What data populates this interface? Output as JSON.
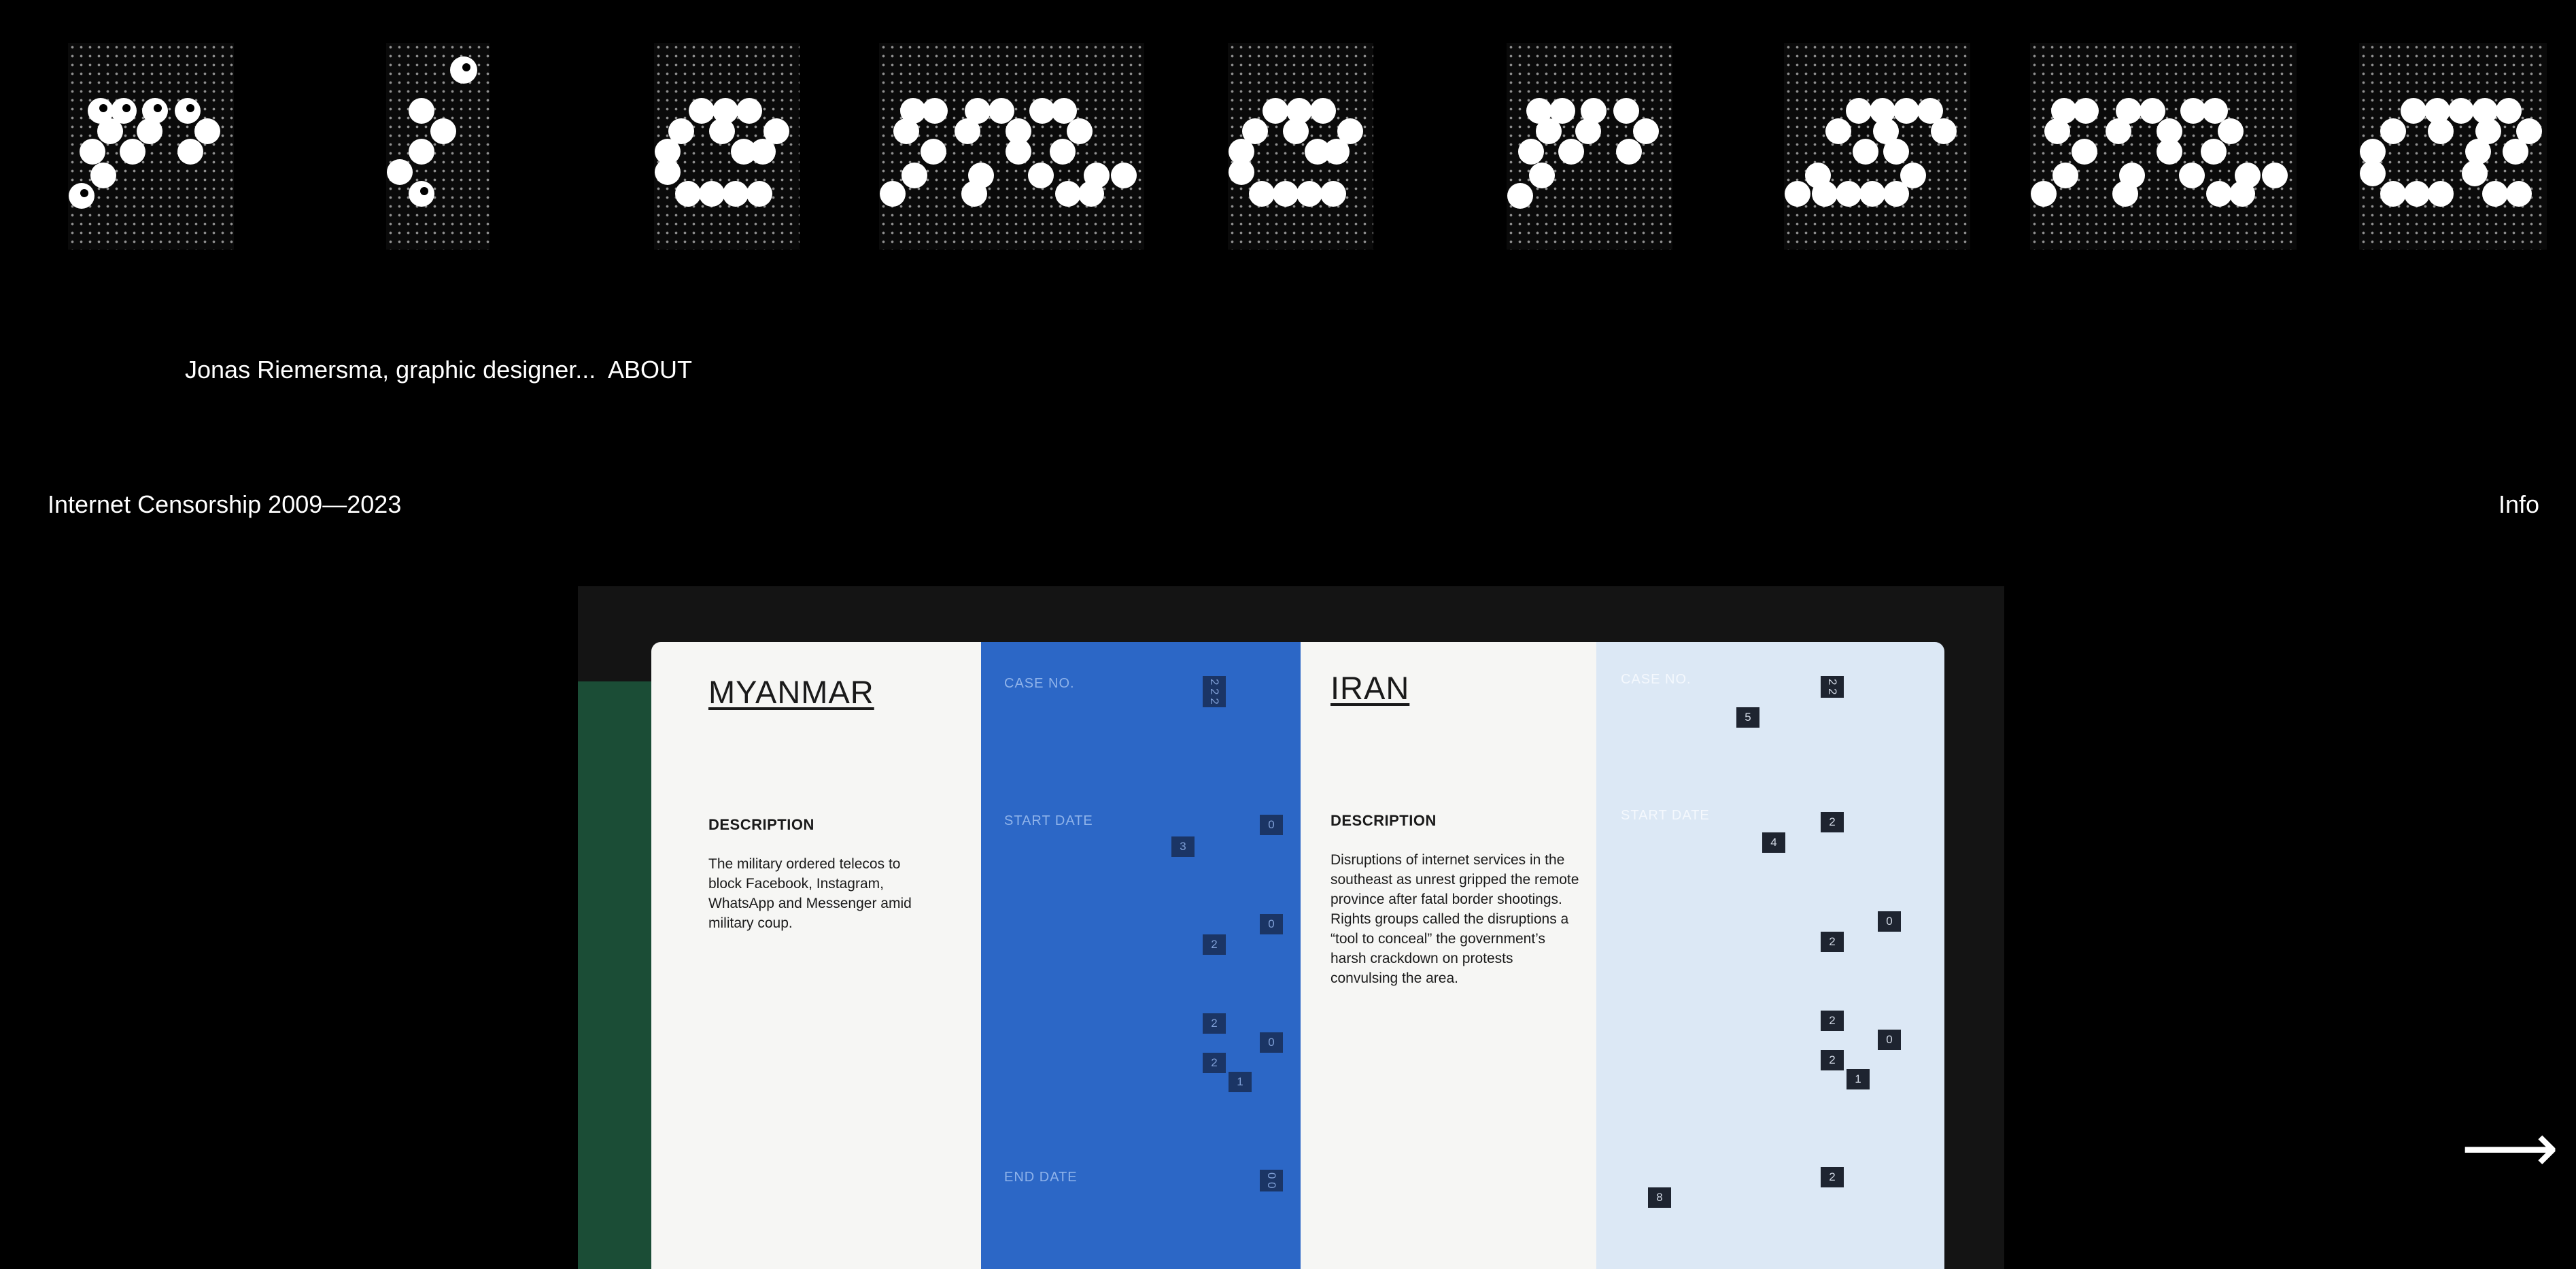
{
  "logo_glyph_names": [
    "r-glyph",
    "i-glyph",
    "e-glyph",
    "m-glyph",
    "e-glyph-2",
    "r-glyph-2",
    "s-glyph",
    "m-glyph-2",
    "a-glyph"
  ],
  "nav": {
    "designer": "Jonas Riemersma, graphic designer...",
    "about": "ABOUT"
  },
  "project": {
    "title": "Internet Censorship 2009—2023",
    "info": "Info"
  },
  "next_icon": "right-arrow-icon",
  "next_glyph": "⟶",
  "book": {
    "left": {
      "country": "MYANMAR",
      "description_label": "DESCRIPTION",
      "description": "The military ordered telecos to block Facebook, Instagram, WhatsApp and Messenger amid military coup.",
      "case_no_label": "CASE NO.",
      "start_date_label": "START DATE",
      "end_date_label": "END DATE",
      "case_digits": "2 2 2",
      "start_digits": [
        "0",
        "3",
        "0",
        "2",
        "2",
        "0",
        "2",
        "1"
      ],
      "end_digits": "0 0"
    },
    "right": {
      "country": "IRAN",
      "description_label": "DESCRIPTION",
      "description": "Disruptions of internet services in the southeast as unrest gripped the remote province after fatal border shootings. Rights groups called the disruptions a “tool to conceal” the government’s harsh crackdown on protests convulsing the area.",
      "case_no_label": "CASE NO.",
      "start_date_label": "START DATE",
      "case_digits": "2 2",
      "start_digits": [
        "5",
        "2",
        "4",
        "0",
        "2",
        "2",
        "0",
        "2",
        "1",
        "2",
        "8"
      ]
    }
  },
  "colors": {
    "background": "#000000",
    "text": "#ffffff",
    "blue_page": "#2c67c6",
    "light_blue_page": "#dce8f5"
  }
}
